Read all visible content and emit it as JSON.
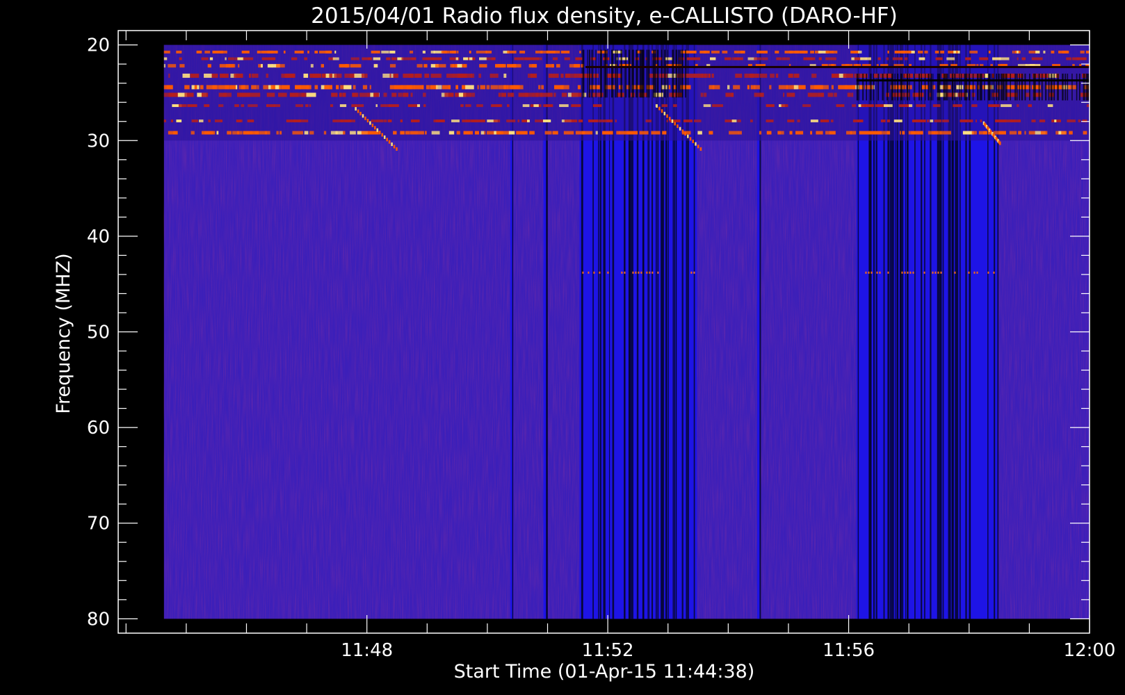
{
  "chart_data": {
    "type": "heatmap",
    "title": "2015/04/01  Radio flux density, e-CALLISTO (DARO-HF)",
    "xlabel": "Start Time (01-Apr-15 11:44:38)",
    "ylabel": "Frequency (MHZ)",
    "x_ticks": [
      {
        "minutes": 3.37,
        "label": "11:48"
      },
      {
        "minutes": 7.37,
        "label": "11:52"
      },
      {
        "minutes": 11.37,
        "label": "11:56"
      },
      {
        "minutes": 15.37,
        "label": "12:00"
      }
    ],
    "y_ticks": [
      20,
      30,
      40,
      50,
      60,
      70,
      80
    ],
    "xlim_minutes": [
      -0.76,
      15.37
    ],
    "ylim_mhz": [
      18.5,
      81.5
    ],
    "data_extent": {
      "t_start_min": 0.0,
      "t_end_min": 15.37,
      "f_min_mhz": 20,
      "f_max_mhz": 80
    },
    "y_inverted": true,
    "colormap": {
      "low": "#1e14e6",
      "background": "#3c1fb9",
      "mid": "#b41e1e",
      "high": "#ff5a00",
      "peak": "#ffe080"
    },
    "emission_band_mhz": [
      20,
      30
    ],
    "dark_gaps_minutes": [
      [
        5.75,
        5.8
      ],
      [
        6.3,
        6.37
      ],
      [
        6.9,
        8.85
      ],
      [
        9.85,
        9.9
      ],
      [
        11.5,
        13.85
      ]
    ],
    "weak_lines_mhz": [
      43.7
    ],
    "drifting_bursts": [
      {
        "t_start_min": 3.17,
        "t_end_min": 3.85,
        "f_start_mhz": 26.5,
        "f_end_mhz": 30.7
      },
      {
        "t_start_min": 8.17,
        "t_end_min": 8.9,
        "f_start_mhz": 26.2,
        "f_end_mhz": 30.7
      },
      {
        "t_start_min": 13.6,
        "t_end_min": 13.87,
        "f_start_mhz": 28.0,
        "f_end_mhz": 30.1
      }
    ],
    "grid": false,
    "legend": "none"
  }
}
